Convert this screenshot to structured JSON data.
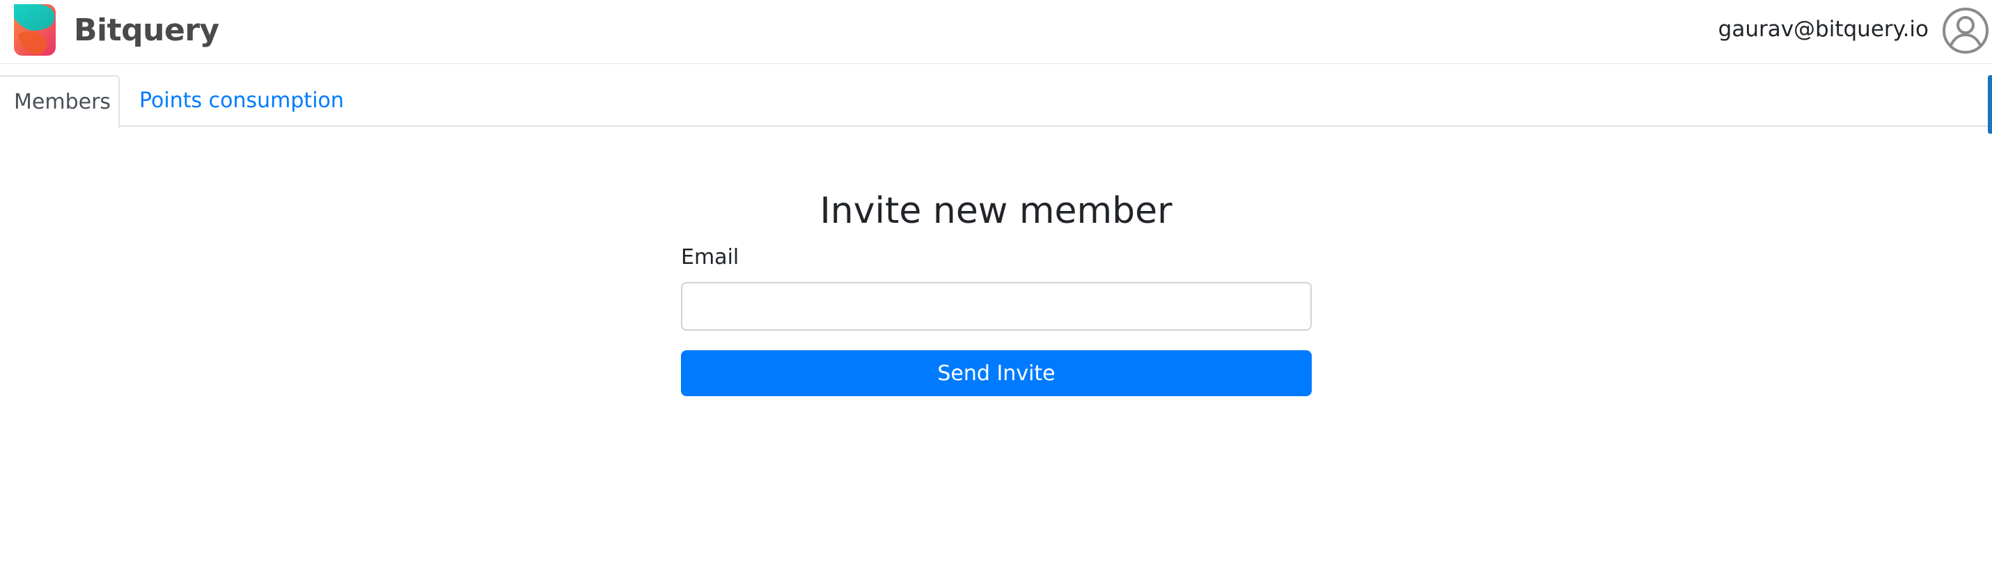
{
  "header": {
    "brand": "Bitquery",
    "user_email": "gaurav@bitquery.io",
    "logo_icon": "bitquery-logo",
    "avatar_icon": "user-avatar-icon"
  },
  "tabs": [
    {
      "label": "Members",
      "active": true
    },
    {
      "label": "Points consumption",
      "active": false
    }
  ],
  "invite_form": {
    "title": "Invite new member",
    "email_label": "Email",
    "email_value": "",
    "email_placeholder": "",
    "submit_label": "Send Invite"
  },
  "colors": {
    "primary": "#007bff",
    "tab_link": "#007bff",
    "brand_text": "#4a4a4a"
  }
}
